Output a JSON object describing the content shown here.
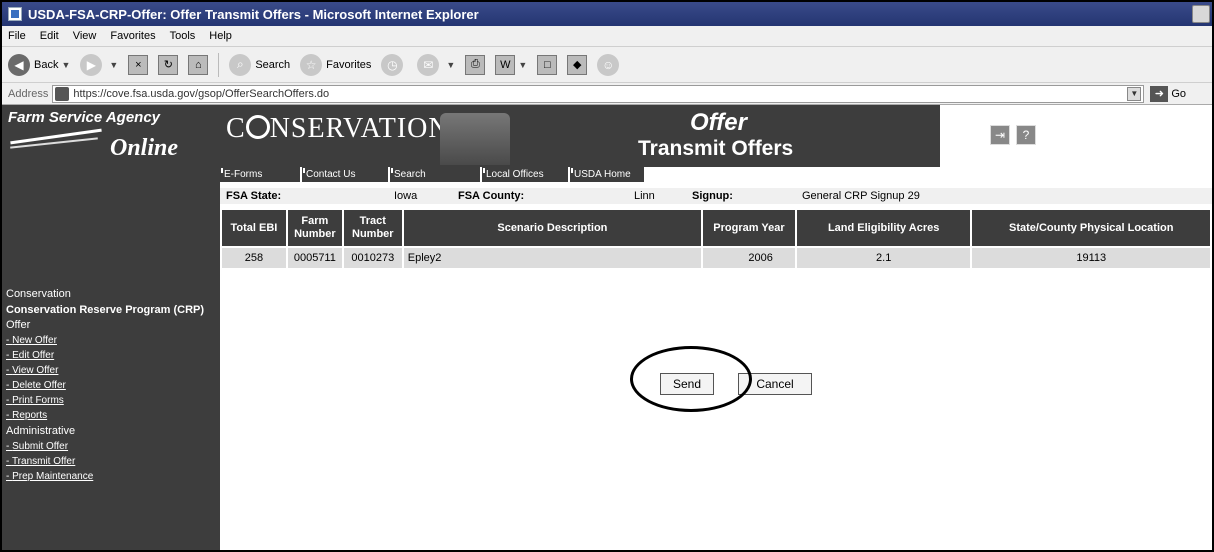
{
  "window": {
    "title": "USDA-FSA-CRP-Offer: Offer Transmit Offers - Microsoft Internet Explorer"
  },
  "menubar": {
    "items": [
      "File",
      "Edit",
      "View",
      "Favorites",
      "Tools",
      "Help"
    ]
  },
  "toolbar": {
    "back_label": "Back",
    "search_label": "Search",
    "favorites_label": "Favorites"
  },
  "addressbar": {
    "label": "Address",
    "url": "https://cove.fsa.usda.gov/gsop/OfferSearchOffers.do",
    "go_label": "Go"
  },
  "banner": {
    "agency_line1": "Farm Service Agency",
    "agency_line2": "Online",
    "conservation_title": "NSERVATION",
    "conservation_prefix": "C",
    "page_title": "Offer",
    "page_subtitle": "Transmit Offers",
    "nav_tabs": [
      "E-Forms",
      "Contact Us",
      "Search",
      "Local Offices",
      "USDA Home"
    ]
  },
  "sidebar": {
    "heading": "Conservation",
    "program": "Conservation Reserve Program (CRP)",
    "offer_section": "Offer",
    "offer_links": [
      "New Offer",
      "Edit Offer",
      "View Offer",
      "Delete Offer",
      "Print Forms",
      "Reports"
    ],
    "admin_section": "Administrative",
    "admin_links": [
      "Submit Offer",
      "Transmit Offer",
      "Prep Maintenance"
    ]
  },
  "info": {
    "state_label": "FSA State:",
    "state_value": "Iowa",
    "county_label": "FSA County:",
    "county_value": "Linn",
    "signup_label": "Signup:",
    "signup_value": "General CRP Signup 29"
  },
  "table": {
    "headers": [
      "Total EBI",
      "Farm Number",
      "Tract Number",
      "Scenario Description",
      "Program Year",
      "Land Eligibility Acres",
      "State/County Physical Location"
    ],
    "rows": [
      [
        "258",
        "0005711",
        "0010273",
        "Epley2",
        "2006",
        "2.1",
        "19113"
      ]
    ]
  },
  "actions": {
    "send_label": "Send",
    "cancel_label": "Cancel"
  }
}
